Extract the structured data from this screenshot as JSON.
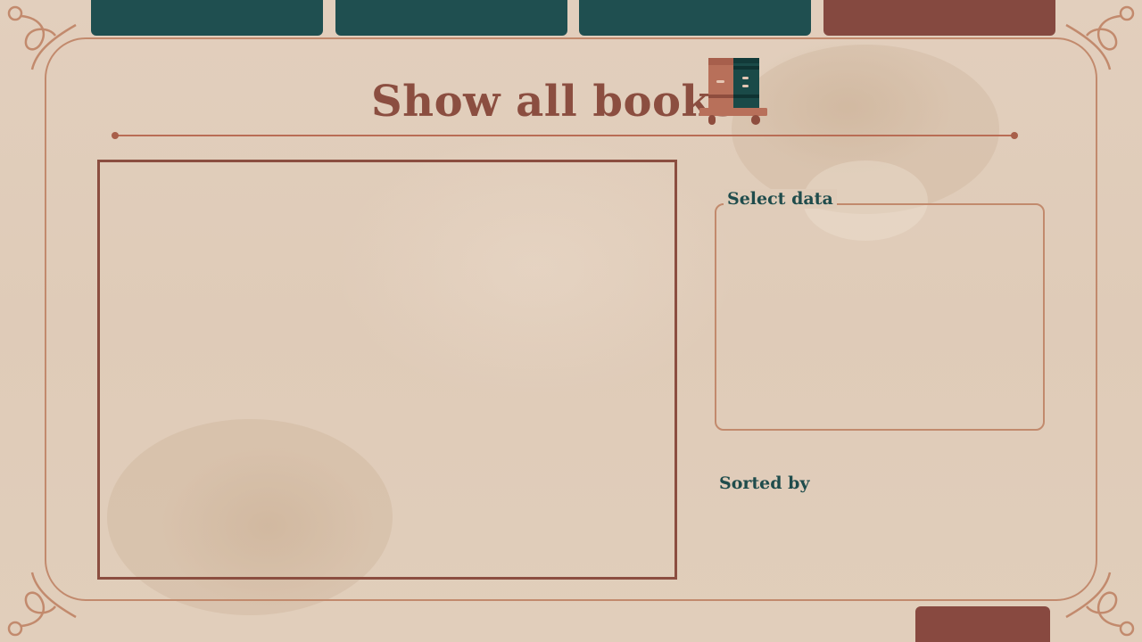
{
  "nav": {
    "tabs": [
      {
        "label": "",
        "color": "#1f4f50"
      },
      {
        "label": "",
        "color": "#1f4f50"
      },
      {
        "label": "",
        "color": "#1f4f50"
      },
      {
        "label": "",
        "color": "#854940"
      }
    ]
  },
  "header": {
    "title": "Show all books",
    "icon": "bookshelf-icon"
  },
  "main": {
    "canvas_label": ""
  },
  "sidebar": {
    "select_legend": "Select data",
    "sorted_label": "Sorted by"
  },
  "footer": {
    "button_label": ""
  },
  "colors": {
    "teal": "#1f4f50",
    "rust": "#854940",
    "frame": "#c28a6d",
    "title": "#8b4e40",
    "label": "#1f4c4c",
    "paper": "#e3d0bf"
  }
}
